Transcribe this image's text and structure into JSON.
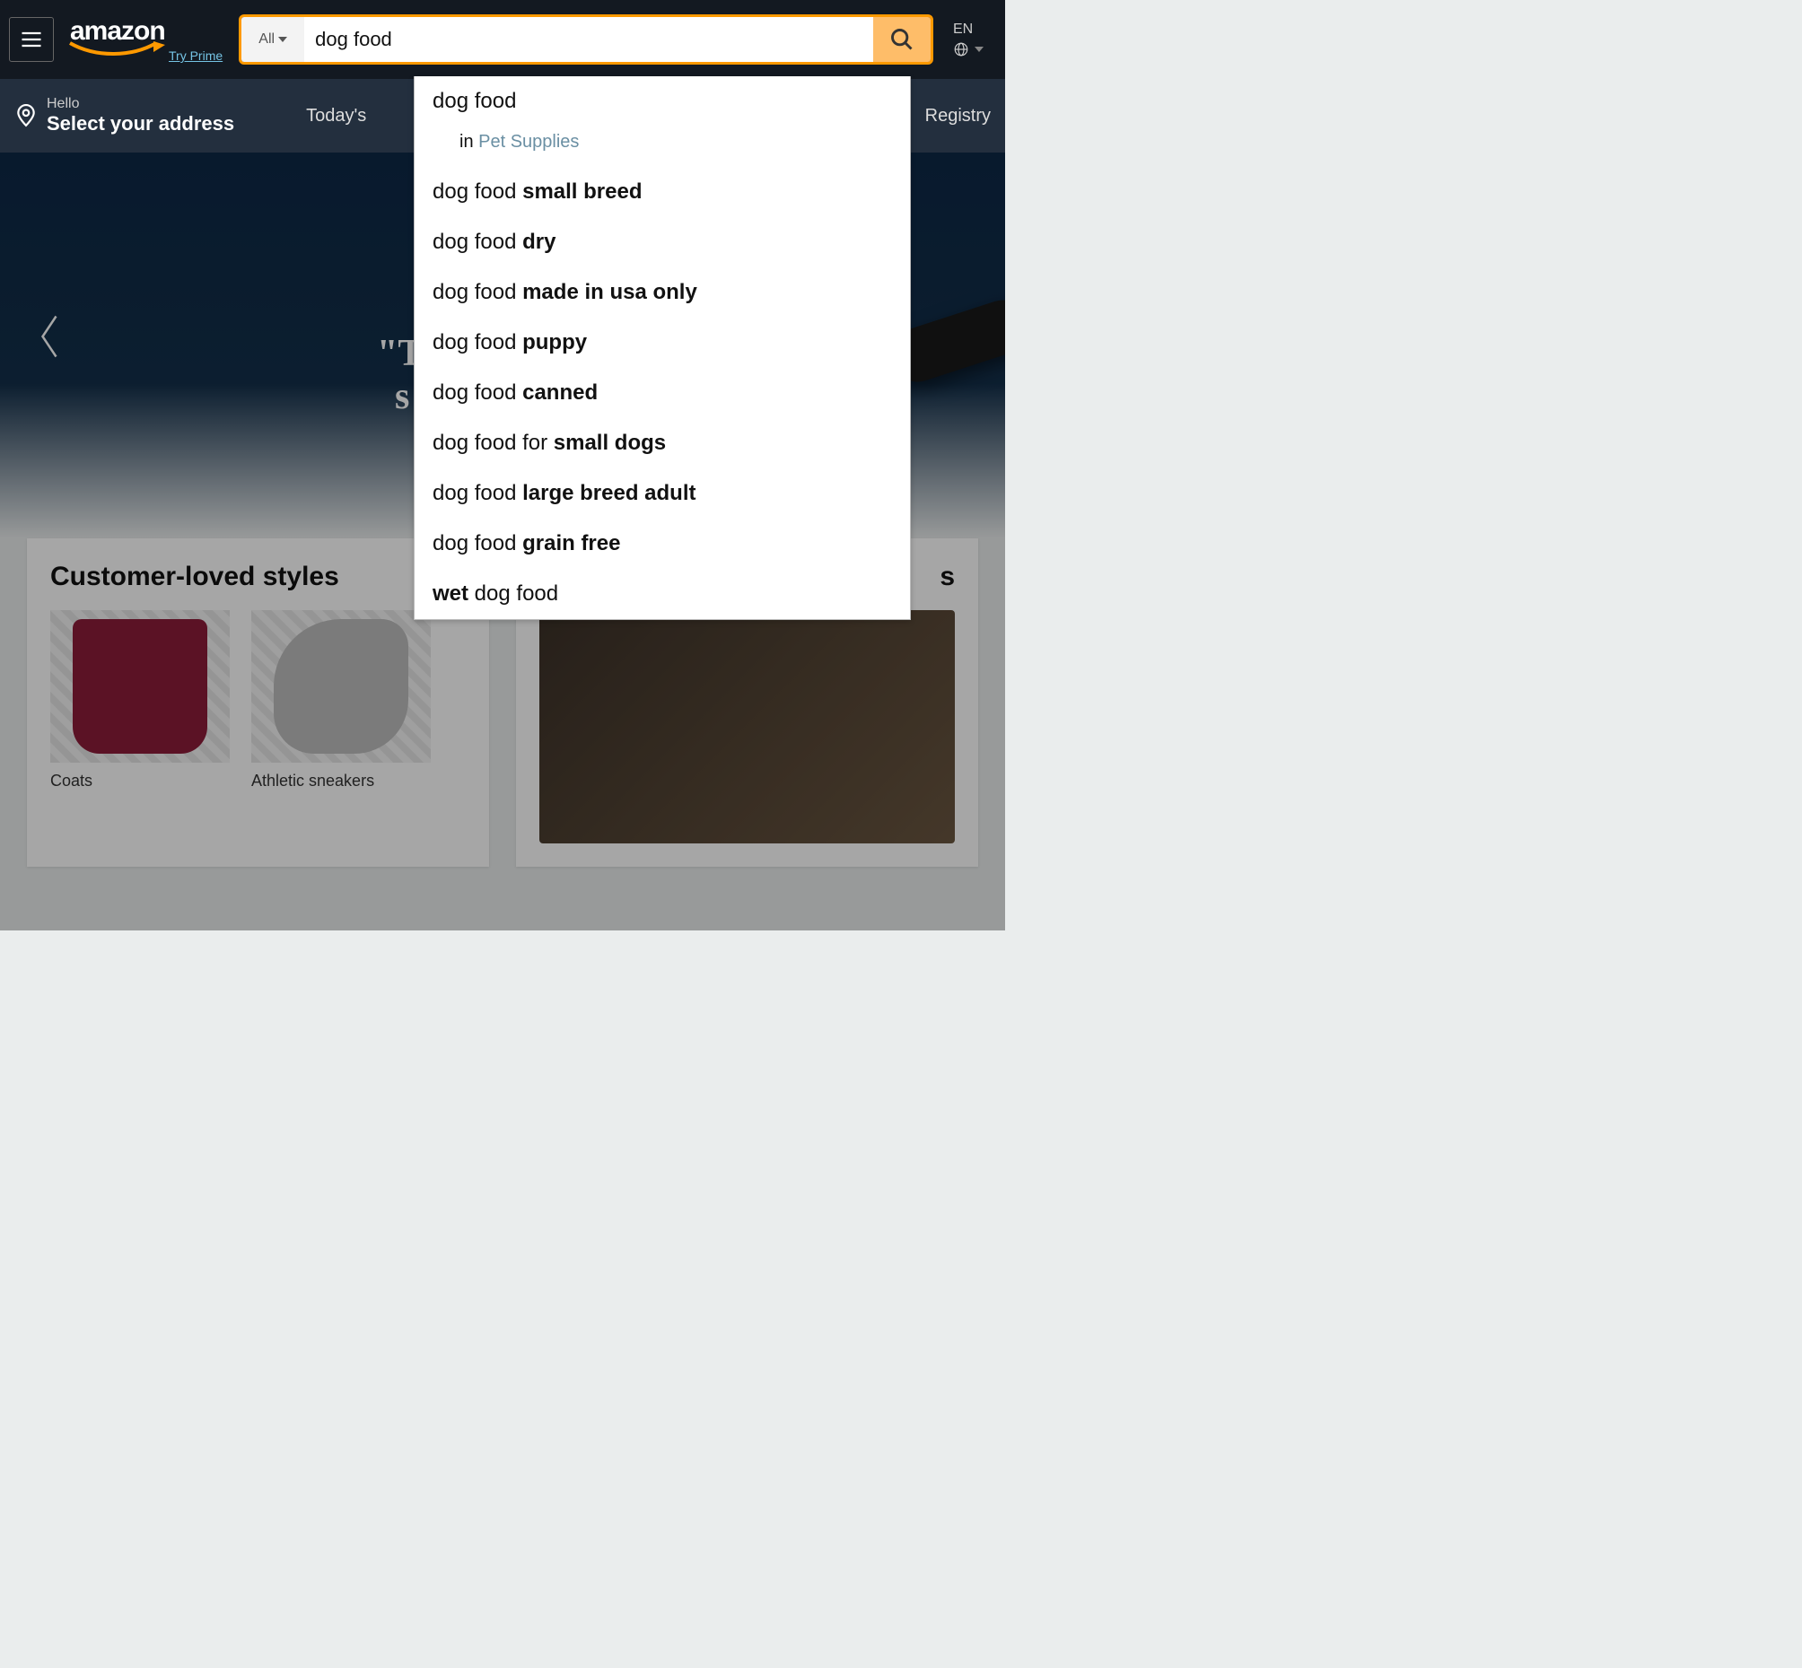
{
  "header": {
    "logo_text": "amazon",
    "try_prime": "Try Prime",
    "search_dept": "All",
    "search_value": "dog food",
    "lang": "EN"
  },
  "subnav": {
    "hello": "Hello",
    "select_address": "Select your address",
    "todays": "Today's",
    "registry": "Registry"
  },
  "hero": {
    "line1": "\"T",
    "line2": "s"
  },
  "suggestions": {
    "first": "dog food",
    "sub_in": "in ",
    "sub_cat": "Pet Supplies",
    "items": [
      {
        "match": "dog food ",
        "extra": "small breed"
      },
      {
        "match": "dog food ",
        "extra": "dry"
      },
      {
        "match": "dog food ",
        "extra": "made in usa only"
      },
      {
        "match": "dog food ",
        "extra": "puppy"
      },
      {
        "match": "dog food ",
        "extra": "canned"
      },
      {
        "match": "dog food for ",
        "extra": "small dogs"
      },
      {
        "match": "dog food ",
        "extra": "large breed adult"
      },
      {
        "match": "dog food ",
        "extra": "grain free"
      },
      {
        "match_bold": "wet",
        "match_after": " dog food"
      }
    ]
  },
  "cards": {
    "left_title": "Customer-loved styles",
    "tile1": "Coats",
    "tile2": "Athletic sneakers",
    "right_title_tail": "s"
  }
}
